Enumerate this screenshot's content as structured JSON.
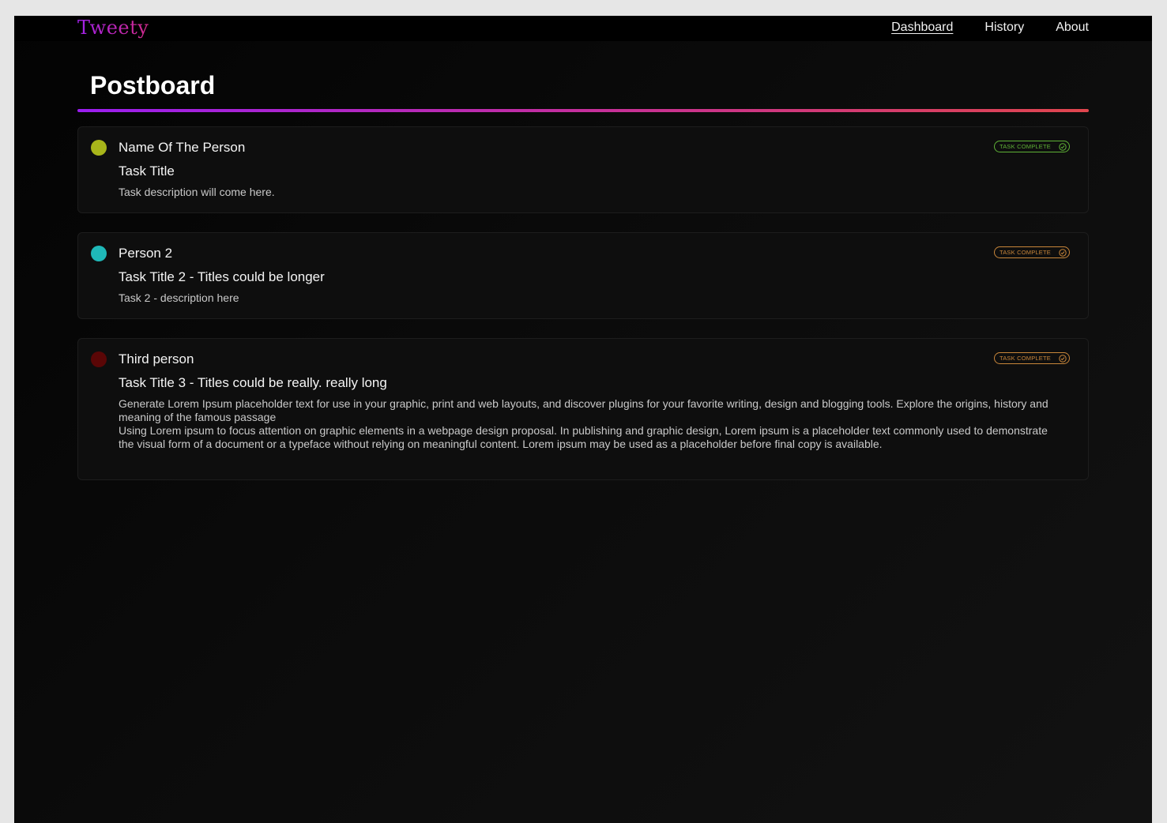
{
  "app": {
    "logo": "Tweety"
  },
  "nav": {
    "items": [
      {
        "label": "Dashboard",
        "active": true
      },
      {
        "label": "History",
        "active": false
      },
      {
        "label": "About",
        "active": false
      }
    ]
  },
  "page": {
    "title": "Postboard"
  },
  "tasks": [
    {
      "person": "Name Of The Person",
      "title": "Task Title",
      "description": "Task description will come here.",
      "dot_color": "#a8b51a",
      "status_label": "TASK COMPLETE",
      "status_color": "#5fb236",
      "status_icon": "check-circle-icon"
    },
    {
      "person": "Person 2",
      "title": "Task Title 2 - Titles could be longer",
      "description": "Task 2 - description here",
      "dot_color": "#1fb8b8",
      "status_label": "TASK COMPLETE",
      "status_color": "#c8863a",
      "status_icon": "check-circle-icon"
    },
    {
      "person": "Third person",
      "title": "Task Title 3 - Titles could be really. really long",
      "description_lines": [
        "Generate Lorem Ipsum placeholder text for use in your graphic, print and web layouts, and discover plugins for your favorite writing, design and blogging tools. Explore the origins, history and meaning of the famous passage",
        "Using Lorem ipsum to focus attention on graphic elements in a webpage design proposal. In publishing and graphic design, Lorem ipsum is a placeholder text commonly used to demonstrate the visual form of a document or a typeface without relying on meaningful content. Lorem ipsum may be used as a placeholder before final copy is available."
      ],
      "dot_color": "#5a0606",
      "status_label": "TASK COMPLETE",
      "status_color": "#c8863a",
      "status_icon": "check-circle-icon"
    }
  ]
}
